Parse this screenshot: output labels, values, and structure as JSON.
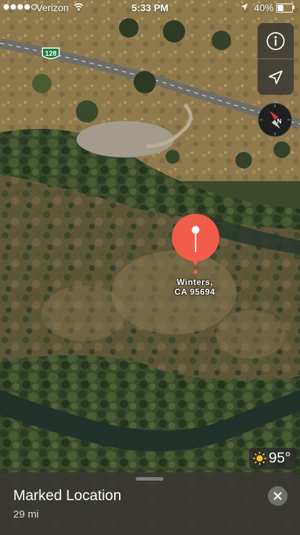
{
  "status_bar": {
    "carrier": "Verizon",
    "time": "5:33 PM",
    "battery_pct": "40%",
    "battery_level": 0.4,
    "signal_bars": 4
  },
  "map": {
    "route_shield": "128",
    "pin_label_line1": "Winters,",
    "pin_label_line2": "CA 95694",
    "pin_color": "#f25c4b"
  },
  "controls": {
    "info_icon": "info-icon",
    "tracking_icon": "location-arrow-icon",
    "compass_letter": "N"
  },
  "weather": {
    "temperature": "95°",
    "icon": "sun-icon"
  },
  "sheet": {
    "title": "Marked Location",
    "distance": "29 mi",
    "close_icon": "close-icon"
  }
}
